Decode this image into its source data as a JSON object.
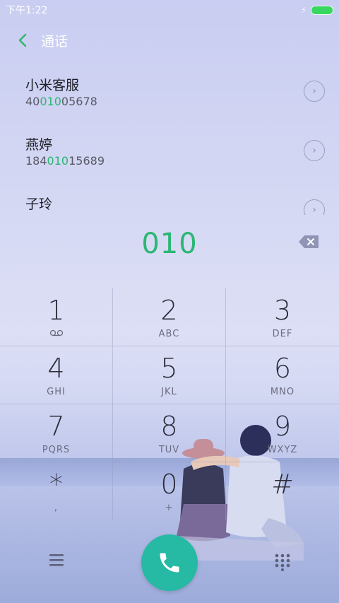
{
  "status_bar": {
    "time": "下午1:22",
    "battery_color": "#38d860"
  },
  "header": {
    "title": "通话",
    "back_icon": "chevron-left-icon"
  },
  "results": [
    {
      "name": "小米客服",
      "number_pre": "40",
      "number_match": "010",
      "number_post": "05678"
    },
    {
      "name": "燕婷",
      "number_pre": "184",
      "number_match": "010",
      "number_post": "15689"
    },
    {
      "name": "子玲",
      "number_pre": "",
      "number_match": "",
      "number_post": ""
    }
  ],
  "input": {
    "digits": "010",
    "accent_color": "#2bb673"
  },
  "keypad": {
    "keys": [
      {
        "digit": "1",
        "letters": ""
      },
      {
        "digit": "2",
        "letters": "ABC"
      },
      {
        "digit": "3",
        "letters": "DEF"
      },
      {
        "digit": "4",
        "letters": "GHI"
      },
      {
        "digit": "5",
        "letters": "JKL"
      },
      {
        "digit": "6",
        "letters": "MNO"
      },
      {
        "digit": "7",
        "letters": "PQRS"
      },
      {
        "digit": "8",
        "letters": "TUV"
      },
      {
        "digit": "9",
        "letters": "WXYZ"
      },
      {
        "digit": "*",
        "letters": ","
      },
      {
        "digit": "0",
        "letters": "+"
      },
      {
        "digit": "#",
        "letters": ""
      }
    ]
  },
  "bottom_bar": {
    "call_color": "#26b9a4"
  }
}
